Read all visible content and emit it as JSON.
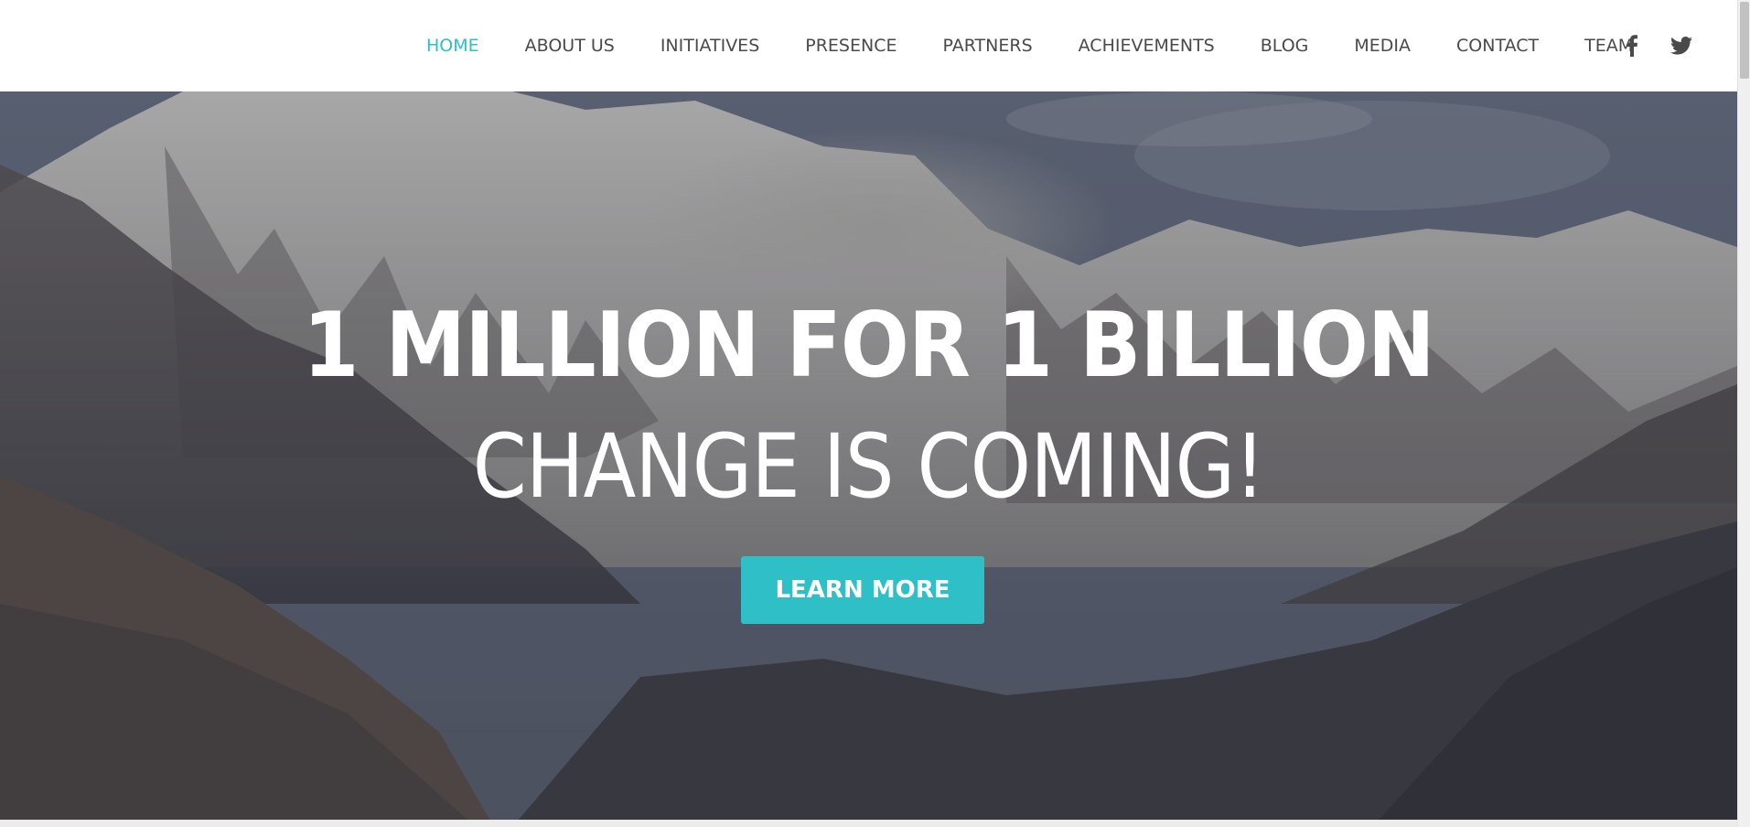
{
  "nav": {
    "items": [
      {
        "label": "HOME",
        "active": true
      },
      {
        "label": "ABOUT US",
        "active": false
      },
      {
        "label": "INITIATIVES",
        "active": false
      },
      {
        "label": "PRESENCE",
        "active": false
      },
      {
        "label": "PARTNERS",
        "active": false
      },
      {
        "label": "ACHIEVEMENTS",
        "active": false
      },
      {
        "label": "BLOG",
        "active": false
      },
      {
        "label": "MEDIA",
        "active": false
      },
      {
        "label": "CONTACT",
        "active": false
      },
      {
        "label": "TEAM",
        "active": false
      }
    ],
    "social_icons": [
      "facebook-icon",
      "twitter-icon"
    ]
  },
  "hero": {
    "headline": "1 MILLION FOR 1 BILLION",
    "subline": "CHANGE IS COMING!",
    "cta_label": "LEARN MORE"
  },
  "colors": {
    "accent": "#2ebfc7",
    "nav_text": "#4a4a4a",
    "hero_text": "#ffffff"
  }
}
